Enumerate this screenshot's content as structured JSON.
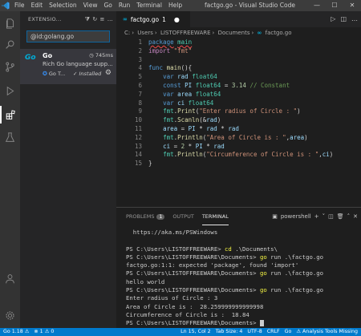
{
  "window": {
    "menu": [
      "File",
      "Edit",
      "Selection",
      "View",
      "Go",
      "Run",
      "Terminal",
      "Help"
    ],
    "title": "factgo.go - Visual Studio Code",
    "controls": {
      "minimize": "—",
      "maximize": "☐",
      "close": "✕"
    }
  },
  "sidebar": {
    "title": "EXTENSIO...",
    "search_value": "@id:golang.go",
    "extension": {
      "logo": "Go",
      "name": "Go",
      "time": "745ms",
      "description": "Rich Go language supp...",
      "publisher": "Go T...",
      "status": "Installed"
    }
  },
  "editor": {
    "tab_label": "factgo.go",
    "tab_badge": "1",
    "breadcrumb": [
      "C:",
      "Users",
      "LISTOFFREEWARE",
      "Documents",
      "factgo.go"
    ],
    "line_numbers": [
      "1",
      "2",
      "3",
      "4",
      "5",
      "6",
      "7",
      "8",
      "9",
      "10",
      "11",
      "12",
      "13",
      "14",
      "15"
    ]
  },
  "panel": {
    "tabs": {
      "problems": "PROBLEMS",
      "problems_count": "1",
      "output": "OUTPUT",
      "terminal": "TERMINAL",
      "shell": "powershell"
    },
    "terminal": {
      "l1": "  https://aka.ms/PSWindows",
      "l2": "",
      "l3_prompt": "PS C:\\Users\\LISTOFFREEWARE> ",
      "l3_cmd": "cd",
      "l3_args": " .\\Documents\\",
      "l4_prompt": "PS C:\\Users\\LISTOFFREEWARE\\Documents> ",
      "l4_cmd": "go",
      "l4_args": " run .\\factgo.go",
      "l5": "factgo.go:1:1: expected 'package', found 'import'",
      "l6_prompt": "PS C:\\Users\\LISTOFFREEWARE\\Documents> ",
      "l6_cmd": "go",
      "l6_args": " run .\\factgo.go",
      "l7": "hello world",
      "l8_prompt": "PS C:\\Users\\LISTOFFREEWARE\\Documents> ",
      "l8_cmd": "go",
      "l8_args": " run .\\factgo.go",
      "l9": "Enter radius of Circle : 3",
      "l10": "Area of Circle is :  28.259999999999998",
      "l11": "Circumference of Circle is :  18.84",
      "l12_prompt": "PS C:\\Users\\LISTOFFREEWARE\\Documents> "
    }
  },
  "statusbar": {
    "go_version": "Go 1.18 ⚠",
    "problems": "⊗ 1  ⚠ 0",
    "position": "Ln 15, Col 2",
    "tab_size": "Tab Size: 4",
    "encoding": "UTF-8",
    "eol": "CRLF",
    "language": "Go",
    "analysis": "⚠ Analysis Tools Missing"
  },
  "colors": {
    "accent": "#007acc",
    "go_brand": "#00add8",
    "editor_bg": "#1e1e1e"
  }
}
